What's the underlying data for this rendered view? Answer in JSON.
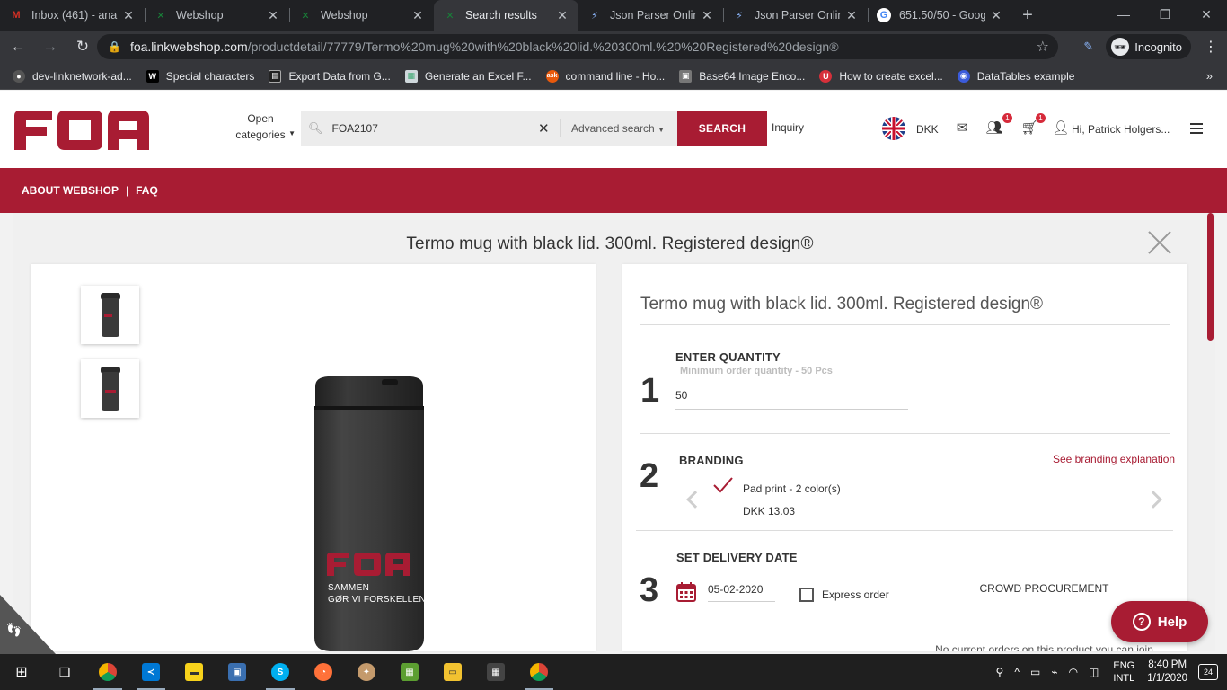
{
  "browser": {
    "tabs": [
      {
        "title": "Inbox (461) - anan",
        "icon": "gmail-icon",
        "color": "#d93025",
        "glyph": "M"
      },
      {
        "title": "Webshop",
        "icon": "webshop-icon",
        "color": "#188038",
        "glyph": "X"
      },
      {
        "title": "Webshop",
        "icon": "webshop-icon",
        "color": "#188038",
        "glyph": "X"
      },
      {
        "title": "Search results",
        "icon": "webshop-icon",
        "color": "#188038",
        "glyph": "X"
      },
      {
        "title": "Json Parser Online",
        "icon": "json-icon",
        "color": "#8ab4f8",
        "glyph": "J"
      },
      {
        "title": "Json Parser Online",
        "icon": "json-icon",
        "color": "#8ab4f8",
        "glyph": "J"
      },
      {
        "title": "651.50/50 - Googl",
        "icon": "google-icon",
        "color": "#4285f4",
        "glyph": "G"
      }
    ],
    "active_tab": 3,
    "url_host": "foa.linkwebshop.com",
    "url_path": "/productdetail/77779/Termo%20mug%20with%20black%20lid.%20300ml.%20%20Registered%20design®",
    "incognito_label": "Incognito",
    "bookmarks": [
      {
        "label": "dev-linknetwork-ad...",
        "color": "#444"
      },
      {
        "label": "Special characters",
        "color": "#000"
      },
      {
        "label": "Export Data from G...",
        "color": "#222"
      },
      {
        "label": "Generate an Excel F...",
        "color": "#6a9"
      },
      {
        "label": "command line - Ho...",
        "color": "#e8590c"
      },
      {
        "label": "Base64 Image Enco...",
        "color": "#777"
      },
      {
        "label": "How to create excel...",
        "color": "#d6303a"
      },
      {
        "label": "DataTables example",
        "color": "#3b5bdb"
      }
    ]
  },
  "header": {
    "open_categories": "Open categories",
    "search_value": "FOA2107",
    "advanced_search": "Advanced search",
    "search_button": "SEARCH",
    "inquiry": "Inquiry",
    "currency": "DKK",
    "users_badge": "1",
    "cart_badge": "1",
    "greeting": "Hi, Patrick Holgers..."
  },
  "nav": {
    "about": "ABOUT WEBSHOP",
    "separator": "|",
    "faq": "FAQ"
  },
  "brand": {
    "accent": "#a81c33",
    "logo_text": "FOA"
  },
  "product": {
    "title": "Termo mug with black lid. 300ml. Registered design®",
    "mug_logo": "FOA",
    "mug_tagline_1": "SAMMEN",
    "mug_tagline_2": "GØR VI FORSKELLEN"
  },
  "steps": {
    "quantity": {
      "number": "1",
      "label": "ENTER QUANTITY",
      "min_text": "Minimum order quantity - 50 Pcs",
      "value": "50"
    },
    "branding": {
      "number": "2",
      "label": "BRANDING",
      "link": "See branding explanation",
      "option_name": "Pad print - 2 color(s)",
      "option_price": "DKK 13.03"
    },
    "delivery": {
      "number": "3",
      "label": "SET DELIVERY DATE",
      "date": "05-02-2020",
      "express_label": "Express order",
      "crowd_title": "CROWD PROCUREMENT",
      "crowd_sub": "No current orders on this product you can join"
    }
  },
  "help": {
    "label": "Help"
  },
  "taskbar": {
    "lang_1": "ENG",
    "lang_2": "INTL",
    "time": "8:40 PM",
    "date": "1/1/2020",
    "notifications": "24"
  }
}
